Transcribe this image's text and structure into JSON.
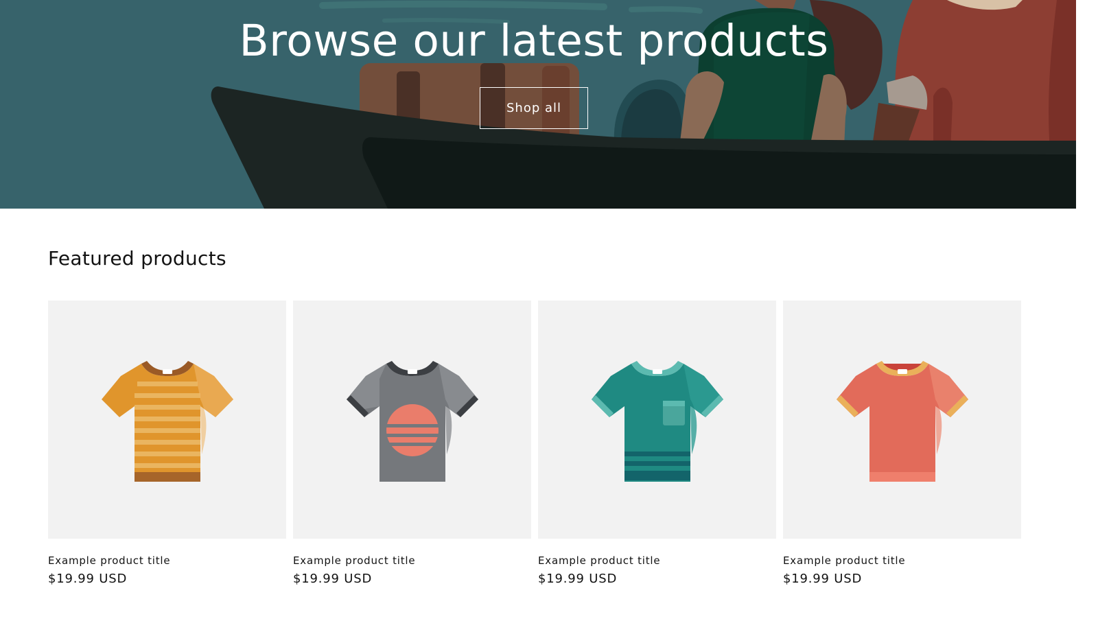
{
  "hero": {
    "title": "Browse our latest products",
    "button_label": "Shop all",
    "background_color": "#37636b"
  },
  "featured": {
    "heading": "Featured products",
    "products": [
      {
        "title": "Example product title",
        "price": "$19.99 USD",
        "icon": "striped-tshirt-icon",
        "color": "#e0952c"
      },
      {
        "title": "Example product title",
        "price": "$19.99 USD",
        "icon": "sunset-tshirt-icon",
        "color": "#75787c"
      },
      {
        "title": "Example product title",
        "price": "$19.99 USD",
        "icon": "pocket-tshirt-icon",
        "color": "#1f8a82"
      },
      {
        "title": "Example product title",
        "price": "$19.99 USD",
        "icon": "plain-tshirt-icon",
        "color": "#e26b5a"
      }
    ]
  }
}
